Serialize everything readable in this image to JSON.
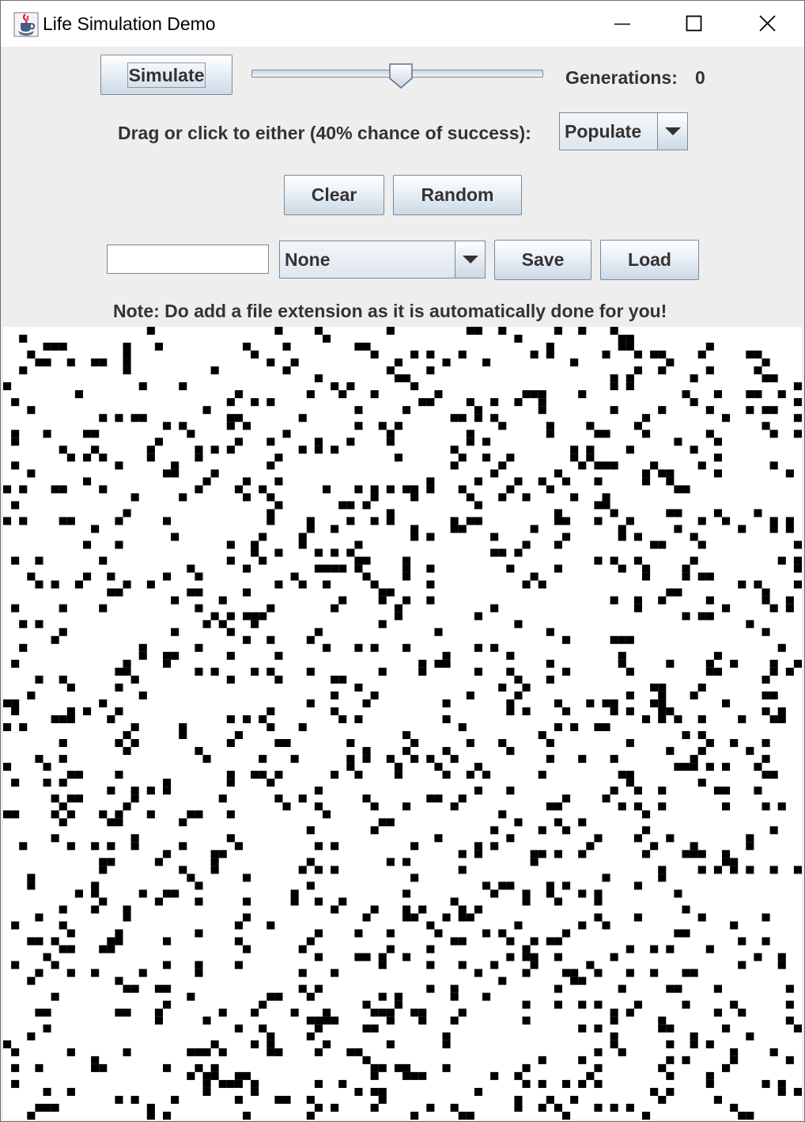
{
  "window": {
    "title": "Life Simulation Demo",
    "icons": {
      "app": "java-cup-icon",
      "minimize": "minimize-icon",
      "maximize": "maximize-icon",
      "close": "close-icon"
    }
  },
  "controls": {
    "simulate_label": "Simulate",
    "speed_slider_fraction": 0.5,
    "generations_label": "Generations:",
    "generations_value": "0",
    "drag_label": "Drag or click to either (40% chance of success):",
    "mode_selected": "Populate",
    "clear_label": "Clear",
    "random_label": "Random",
    "filename_value": "",
    "file_selected": "None",
    "save_label": "Save",
    "load_label": "Load",
    "note": "Note: Do add a file extension as it is automatically done for you!"
  },
  "colors": {
    "live_cell": "#000000",
    "dead_cell": "#ffffff",
    "panel_bg": "#eeeeee"
  },
  "grid": {
    "rows": 100,
    "cols": 100,
    "live_fraction": 0.12
  }
}
